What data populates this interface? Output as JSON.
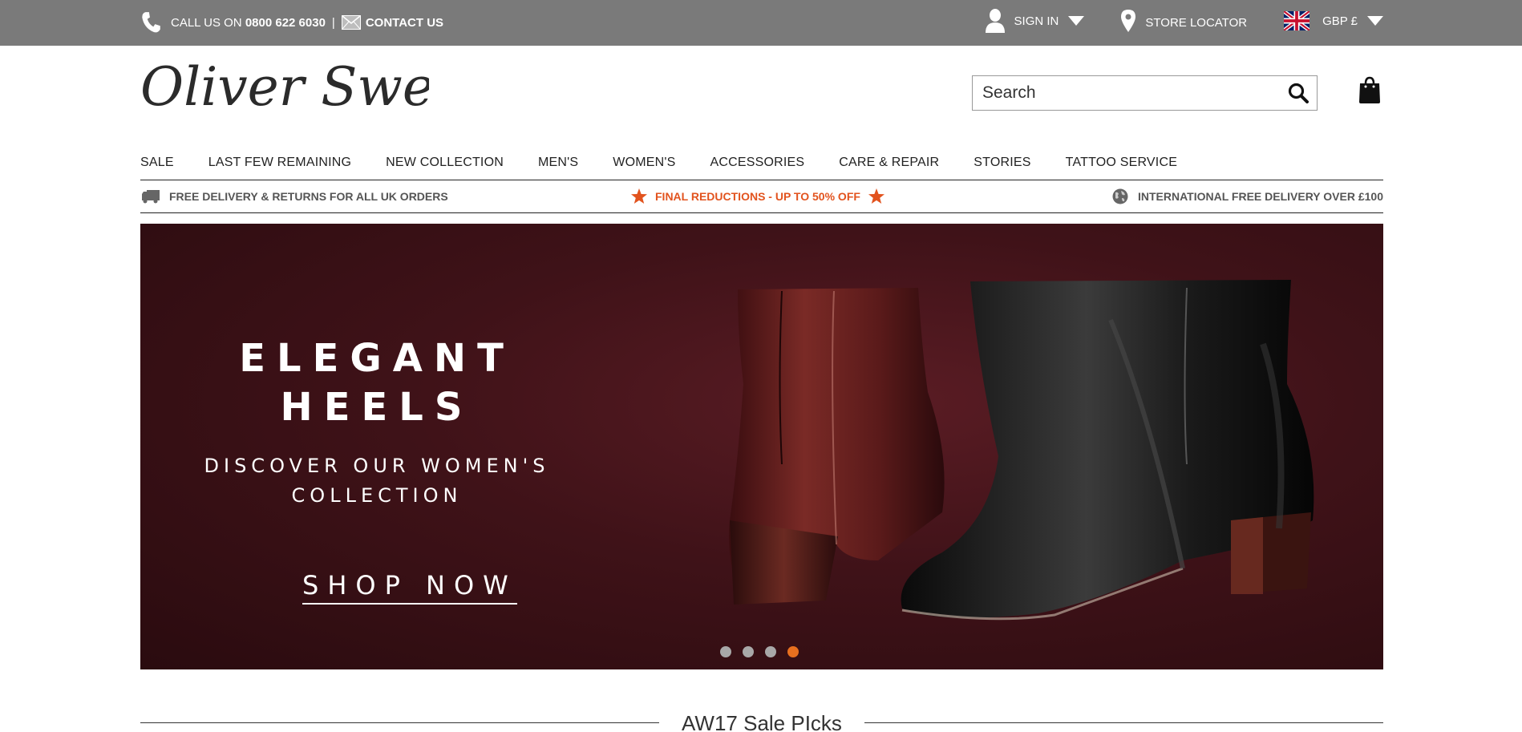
{
  "topbar": {
    "call_prefix": "CALL US ON",
    "phone_number": "0800 622 6030",
    "separator": "|",
    "contact_label": "CONTACT US",
    "sign_in_label": "SIGN IN",
    "store_locator_label": "STORE LOCATOR",
    "currency_label": "GBP £"
  },
  "header": {
    "logo_text": "Oliver Sweeney",
    "search_placeholder": "Search"
  },
  "nav": {
    "items": [
      "SALE",
      "LAST FEW REMAINING",
      "NEW COLLECTION",
      "MEN'S",
      "WOMEN'S",
      "ACCESSORIES",
      "CARE & REPAIR",
      "STORIES",
      "TATTOO SERVICE"
    ]
  },
  "promo": {
    "left": "FREE DELIVERY & RETURNS FOR ALL UK ORDERS",
    "middle": "FINAL REDUCTIONS - UP TO 50% OFF",
    "right": "INTERNATIONAL FREE DELIVERY OVER £100",
    "accent_color": "#e2531e"
  },
  "hero": {
    "title_line1": "ELEGANT",
    "title_line2": "HEELS",
    "subtitle_line1": "DISCOVER OUR WOMEN'S",
    "subtitle_line2": "COLLECTION",
    "cta": "SHOP NOW",
    "slide_count": 4,
    "active_slide": 4,
    "active_dot_color": "#e8701f"
  },
  "section": {
    "title": "AW17 Sale PIcks"
  },
  "icons": [
    "phone-icon",
    "mail-icon",
    "user-icon",
    "chevron-down-icon",
    "map-pin-icon",
    "uk-flag-icon",
    "search-icon",
    "shopping-bag-icon",
    "truck-icon",
    "star-icon",
    "globe-icon"
  ]
}
